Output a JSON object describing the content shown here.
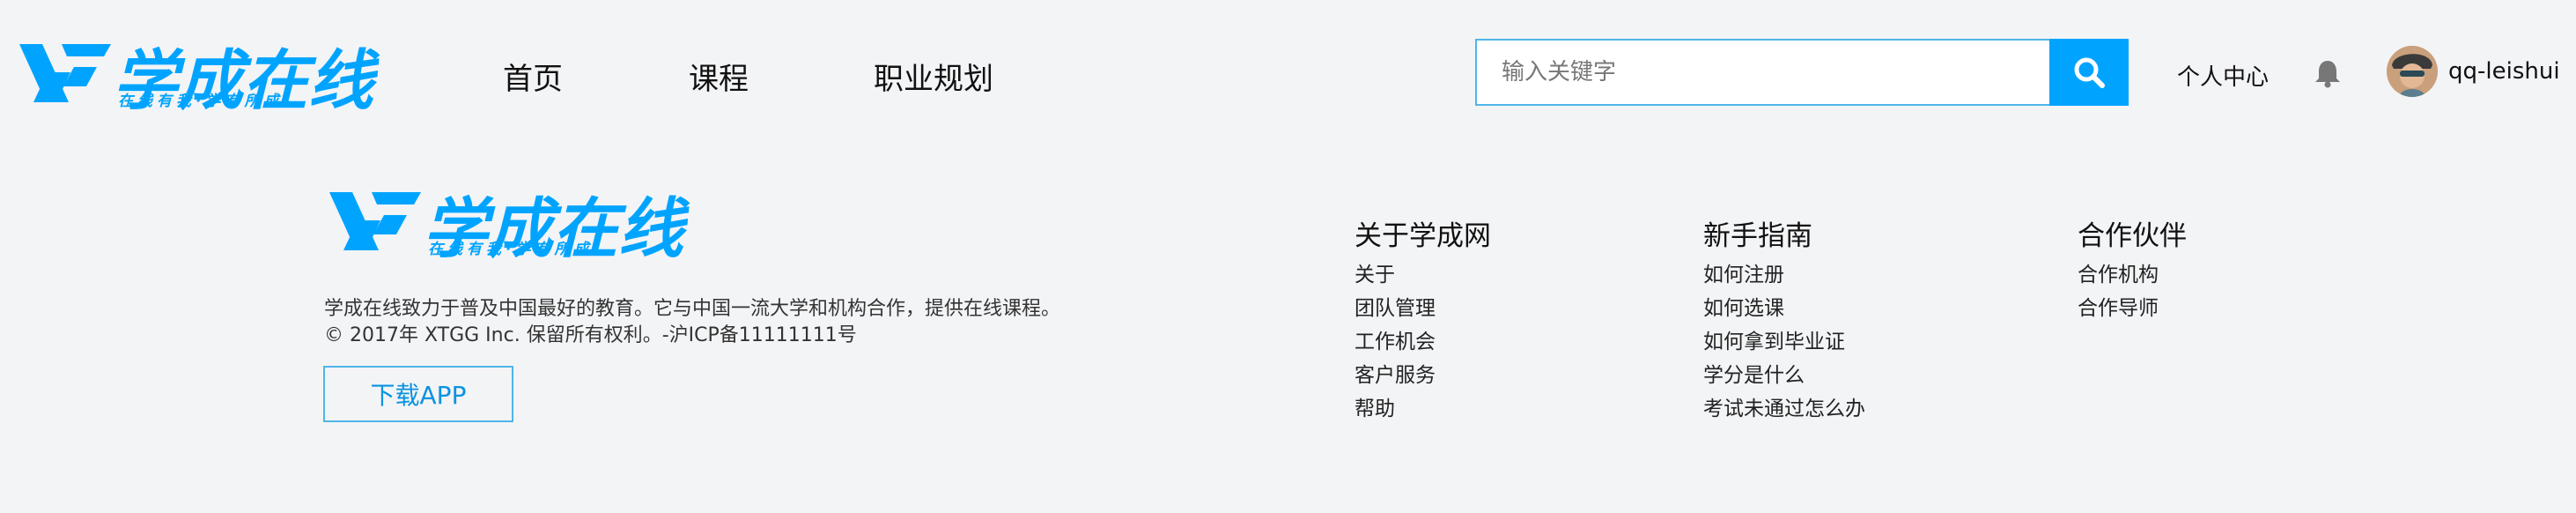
{
  "header": {
    "logo": {
      "wordmark": "学成在线",
      "tagline": "在线有我·学有所成"
    },
    "nav": [
      {
        "label": "首页"
      },
      {
        "label": "课程"
      },
      {
        "label": "职业规划"
      }
    ],
    "search": {
      "placeholder": "输入关键字",
      "value": ""
    },
    "personal_center": "个人中心",
    "username": "qq-leishui",
    "icons": {
      "search": "search-icon",
      "bell": "bell-icon"
    }
  },
  "footer": {
    "logo": {
      "wordmark": "学成在线",
      "tagline": "在线有我·学有所成"
    },
    "description": [
      "学成在线致力于普及中国最好的教育。它与中国一流大学和机构合作，提供在线课程。",
      "© 2017年 XTGG Inc. 保留所有权利。-沪ICP备11111111号"
    ],
    "download_label": "下载APP",
    "columns": [
      {
        "title": "关于学成网",
        "links": [
          "关于",
          "团队管理",
          "工作机会",
          "客户服务",
          "帮助"
        ]
      },
      {
        "title": "新手指南",
        "links": [
          "如何注册",
          "如何选课",
          "如何拿到毕业证",
          "学分是什么",
          "考试未通过怎么办"
        ]
      },
      {
        "title": "合作伙伴",
        "links": [
          "合作机构",
          "合作导师"
        ]
      }
    ]
  },
  "colors": {
    "accent": "#00a4ff",
    "border": "#4fb6e8",
    "background": "#f3f4f6"
  }
}
